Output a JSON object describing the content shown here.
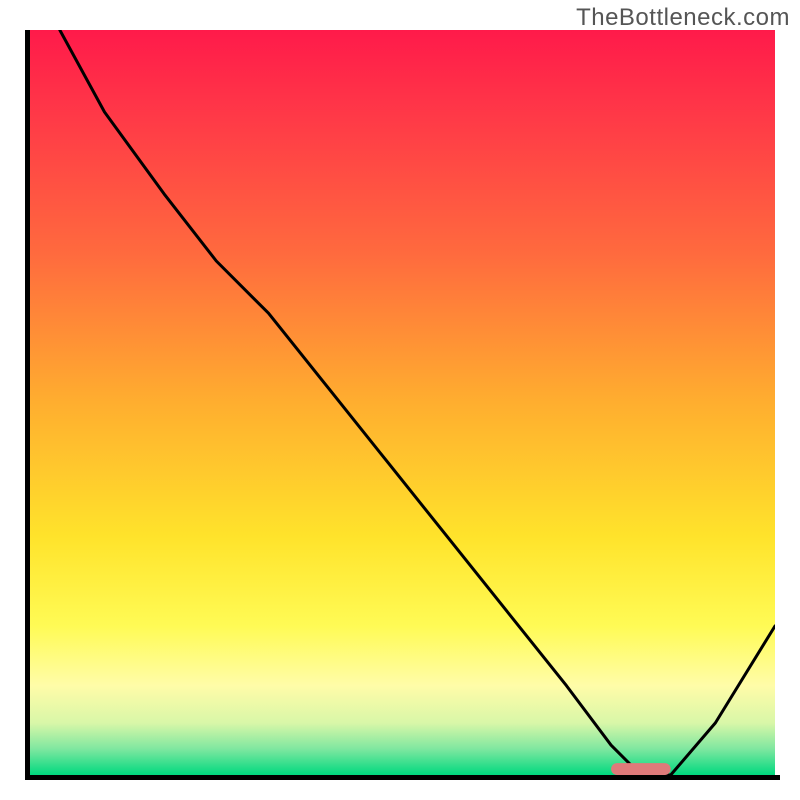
{
  "watermark": "TheBottleneck.com",
  "colors": {
    "curve": "#000000",
    "marker": "#df7a7a",
    "axis": "#000000"
  },
  "gradient_stops": [
    {
      "offset": 0.0,
      "color": "#ff1a4a"
    },
    {
      "offset": 0.12,
      "color": "#ff3a47"
    },
    {
      "offset": 0.3,
      "color": "#ff6a3e"
    },
    {
      "offset": 0.5,
      "color": "#ffae2f"
    },
    {
      "offset": 0.68,
      "color": "#ffe32b"
    },
    {
      "offset": 0.8,
      "color": "#fffb55"
    },
    {
      "offset": 0.88,
      "color": "#fffca8"
    },
    {
      "offset": 0.93,
      "color": "#d9f7a8"
    },
    {
      "offset": 0.965,
      "color": "#7fe7a0"
    },
    {
      "offset": 1.0,
      "color": "#00d97f"
    }
  ],
  "chart_data": {
    "type": "line",
    "title": "",
    "xlabel": "",
    "ylabel": "",
    "xlim": [
      0,
      100
    ],
    "ylim": [
      0,
      100
    ],
    "x": [
      4,
      10,
      18,
      25,
      32,
      40,
      48,
      56,
      64,
      72,
      78,
      82,
      86,
      92,
      100
    ],
    "y": [
      100,
      89,
      78,
      69,
      62,
      52,
      42,
      32,
      22,
      12,
      4,
      0,
      0,
      7,
      20
    ],
    "marker_range": {
      "x_start": 78,
      "x_end": 86,
      "y": 0,
      "height_pct": 1.6
    }
  }
}
